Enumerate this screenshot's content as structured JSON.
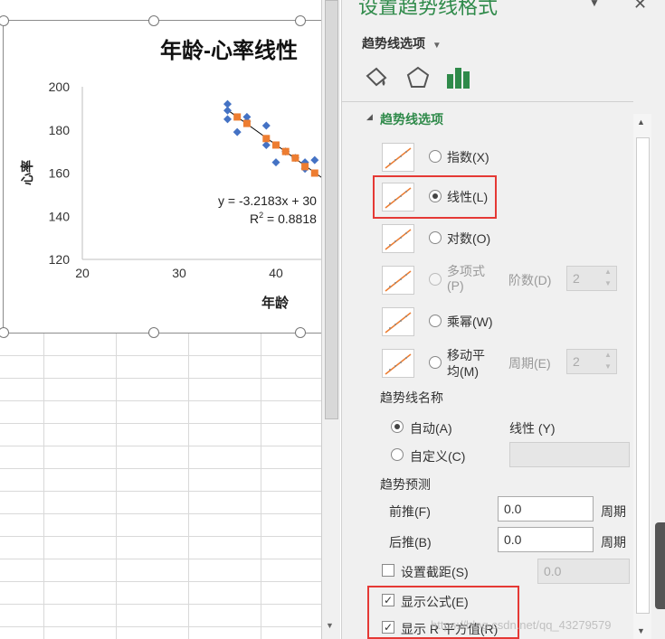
{
  "chart": {
    "title": "年龄-心率线性",
    "xlabel": "年龄",
    "ylabel": "心率",
    "equation": "y = -3.2183x + 30",
    "r2_prefix": "R",
    "r2_suffix": " = 0.8818",
    "r2_sup": "2"
  },
  "chart_data": {
    "type": "scatter",
    "title": "年龄-心率线性",
    "xlabel": "年龄",
    "ylabel": "心率",
    "xlim": [
      20,
      45
    ],
    "ylim": [
      120,
      200
    ],
    "xticks": [
      "20",
      "30",
      "40"
    ],
    "yticks": [
      "120",
      "140",
      "160",
      "180",
      "200"
    ],
    "series": [
      {
        "marker": "diamond",
        "color": "#4472c4",
        "x": [
          35,
          35,
          35,
          36,
          37,
          37,
          39,
          39,
          40,
          41,
          42,
          43,
          43,
          44
        ],
        "y": [
          192,
          189,
          185,
          179,
          186,
          184,
          182,
          173,
          165,
          170,
          167,
          165,
          162,
          166
        ]
      },
      {
        "marker": "square",
        "color": "#ed7d31",
        "x": [
          36,
          37,
          39,
          40,
          41,
          42,
          43,
          44
        ],
        "y": [
          186,
          183,
          176,
          173,
          170,
          167,
          163,
          160
        ]
      }
    ],
    "trendline": {
      "slope": -3.2183,
      "color": "#000000"
    },
    "grid": false
  },
  "pane": {
    "title": "设置趋势线格式",
    "header": "趋势线选项",
    "section": "趋势线选项",
    "options": [
      {
        "label": "指数(X)",
        "checked": false,
        "enabled": true
      },
      {
        "label": "线性(L)",
        "checked": true,
        "enabled": true
      },
      {
        "label": "对数(O)",
        "checked": false,
        "enabled": true
      },
      {
        "label": "多项式(P)",
        "checked": false,
        "enabled": false
      },
      {
        "label": "乘幂(W)",
        "checked": false,
        "enabled": true
      },
      {
        "label": "移动平均(M)",
        "checked": false,
        "enabled": true
      }
    ],
    "poly_label_line1": "多项式",
    "poly_label_line2": "(P)",
    "ma_label_line1": "移动平",
    "ma_label_line2": "均(M)",
    "order_label": "阶数(D)",
    "order_value": "2",
    "period_label": "周期(E)",
    "period_value": "2",
    "name_title": "趋势线名称",
    "auto_label": "自动(A)",
    "auto_value": "线性 (Y)",
    "custom_label": "自定义(C)",
    "custom_value": "",
    "forecast_title": "趋势预测",
    "forward_label": "前推(F)",
    "forward_value": "0.0",
    "backward_label": "后推(B)",
    "backward_value": "0.0",
    "unit": "周期",
    "intercept_label": "设置截距(S)",
    "intercept_value": "0.0",
    "show_equation": "显示公式(E)",
    "show_r2": "显示 R 平方值(R)",
    "watermark": "https://blog.csdn.net/qq_43279579"
  }
}
